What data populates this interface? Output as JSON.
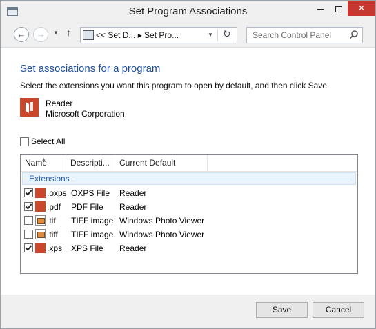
{
  "window": {
    "title": "Set Program Associations",
    "close_glyph": "✕"
  },
  "navigation": {
    "back_glyph": "←",
    "forward_glyph": "→",
    "up_glyph": "↑",
    "address_path": "<<  Set D...  ▸  Set Pro...",
    "refresh_glyph": "↻",
    "search_placeholder": "Search Control Panel"
  },
  "main": {
    "heading": "Set associations for a program",
    "instruction": "Select the extensions you want this program to open by default, and then click Save.",
    "program": {
      "name": "Reader",
      "vendor": "Microsoft Corporation",
      "icon": "reader-app-icon"
    },
    "select_all": {
      "label": "Select All",
      "checked": false
    },
    "list": {
      "columns": [
        "Name",
        "Descripti...",
        "Current Default"
      ],
      "group": "Extensions",
      "rows": [
        {
          "checked": true,
          "icon": "reader-icon",
          "ext": ".oxps",
          "desc": "OXPS File",
          "default": "Reader"
        },
        {
          "checked": true,
          "icon": "reader-icon",
          "ext": ".pdf",
          "desc": "PDF File",
          "default": "Reader"
        },
        {
          "checked": false,
          "icon": "photo-viewer-icon",
          "ext": ".tif",
          "desc": "TIFF image",
          "default": "Windows Photo Viewer"
        },
        {
          "checked": false,
          "icon": "photo-viewer-icon",
          "ext": ".tiff",
          "desc": "TIFF image",
          "default": "Windows Photo Viewer"
        },
        {
          "checked": true,
          "icon": "reader-icon",
          "ext": ".xps",
          "desc": "XPS File",
          "default": "Reader"
        }
      ]
    }
  },
  "footer": {
    "save_label": "Save",
    "cancel_label": "Cancel"
  },
  "colors": {
    "heading": "#1e4e9c",
    "reader_red": "#c9472b",
    "close_button": "#c7372f",
    "group_text": "#1e5fb0"
  }
}
